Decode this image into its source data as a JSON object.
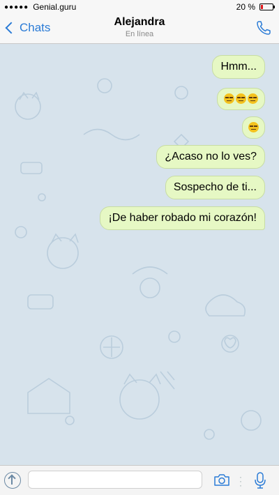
{
  "status_bar": {
    "carrier": "Genial.guru",
    "battery_text": "20 %",
    "battery_level": 0.2,
    "battery_color": "#e0191d"
  },
  "header": {
    "back_label": "Chats",
    "title": "Alejandra",
    "subtitle": "En línea",
    "call_icon": "phone-icon"
  },
  "messages": [
    {
      "text": "Hmm...",
      "emoji_count": 0
    },
    {
      "text": "",
      "emoji_count": 3,
      "emoji": "expressionless-face"
    },
    {
      "text": "",
      "emoji_count": 1,
      "emoji": "expressionless-face"
    },
    {
      "text": "¿Acaso no lo ves?",
      "emoji_count": 0
    },
    {
      "text": "Sospecho de ti...",
      "emoji_count": 0
    },
    {
      "text": "¡De haber robado mi corazón!",
      "emoji_count": 0
    }
  ],
  "input_bar": {
    "attach_icon": "attach-icon",
    "text_value": "",
    "camera_icon": "camera-icon",
    "mic_icon": "microphone-icon"
  },
  "colors": {
    "accent": "#2a7bd6",
    "bubble_out": "#e6f8c4",
    "chat_bg": "#d7e3ec"
  }
}
